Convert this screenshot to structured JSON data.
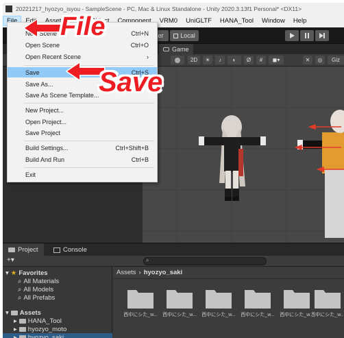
{
  "window": {
    "title": "20221217_hyozyo_isyou - SampleScene - PC, Mac & Linux Standalone - Unity 2020.3.13f1 Personal* <DX11>"
  },
  "menubar": {
    "items": [
      "File",
      "Edit",
      "Assets",
      "GameObject",
      "Component",
      "VRM0",
      "UniGLTF",
      "HANA_Tool",
      "Window",
      "Help"
    ]
  },
  "toolbar": {
    "center_label": "Center",
    "local_label": "Local"
  },
  "scene_tabs": {
    "game": "Game"
  },
  "view_toolbar": {
    "mode_2d": "2D",
    "gizmos": "Giz"
  },
  "file_menu": {
    "items": [
      {
        "label": "New Scene",
        "shortcut": "Ctrl+N"
      },
      {
        "label": "Open Scene",
        "shortcut": "Ctrl+O"
      },
      {
        "label": "Open Recent Scene",
        "shortcut": "›"
      },
      {
        "label": "Save",
        "shortcut": "Ctrl+S"
      },
      {
        "label": "Save As...",
        "shortcut": ""
      },
      {
        "label": "Save As Scene Template...",
        "shortcut": ""
      },
      {
        "label": "New Project...",
        "shortcut": ""
      },
      {
        "label": "Open Project...",
        "shortcut": ""
      },
      {
        "label": "Save Project",
        "shortcut": ""
      },
      {
        "label": "Build Settings...",
        "shortcut": "Ctrl+Shift+B"
      },
      {
        "label": "Build And Run",
        "shortcut": "Ctrl+B"
      },
      {
        "label": "Exit",
        "shortcut": ""
      }
    ]
  },
  "annotations": {
    "file": "File",
    "save": "Save",
    "color": "#ee1d23"
  },
  "bottom_tabs": {
    "project": "Project",
    "console": "Console"
  },
  "project_tree": {
    "favorites": "Favorites",
    "favorite_items": [
      "All Materials",
      "All Models",
      "All Prefabs"
    ],
    "assets": "Assets",
    "asset_items": [
      "HANA_Tool",
      "hyozyo_moto",
      "hyozyo_saki"
    ]
  },
  "breadcrumb": {
    "root": "Assets",
    "current": "hyozyo_saki"
  },
  "folders": [
    "西中にシた_w...",
    "西中にシた_w...",
    "西中にシた_w...",
    "西中にシた_w...",
    "西中にシた_w...",
    "西中にシた_w..."
  ]
}
